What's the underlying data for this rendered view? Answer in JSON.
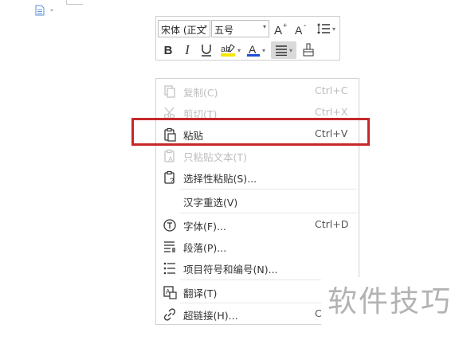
{
  "toolbar": {
    "font_name": "宋体 (正文",
    "font_size": "五号"
  },
  "menu": {
    "items": [
      {
        "label": "复制(C)",
        "shortcut": "Ctrl+C",
        "icon": "copy-icon",
        "disabled": true
      },
      {
        "label": "剪切(T)",
        "shortcut": "Ctrl+X",
        "icon": "scissors-icon",
        "disabled": true
      },
      {
        "label": "粘贴",
        "shortcut": "Ctrl+V",
        "icon": "paste-icon",
        "disabled": false
      },
      {
        "label": "只粘贴文本(T)",
        "shortcut": "",
        "icon": "paste-text-icon",
        "disabled": true
      },
      {
        "label": "选择性粘贴(S)...",
        "shortcut": "",
        "icon": "paste-special-icon",
        "disabled": false
      },
      {
        "label": "汉字重选(V)",
        "shortcut": "",
        "icon": "",
        "disabled": false
      },
      {
        "label": "字体(F)...",
        "shortcut": "Ctrl+D",
        "icon": "font-icon",
        "disabled": false
      },
      {
        "label": "段落(P)...",
        "shortcut": "",
        "icon": "paragraph-icon",
        "disabled": false
      },
      {
        "label": "项目符号和编号(N)...",
        "shortcut": "",
        "icon": "bullet-list-icon",
        "disabled": false
      },
      {
        "label": "翻译(T)",
        "shortcut": "",
        "icon": "translate-icon",
        "disabled": false
      },
      {
        "label": "超链接(H)...",
        "shortcut": "C",
        "icon": "link-icon",
        "disabled": false
      }
    ]
  },
  "watermark": "软件技巧",
  "colors": {
    "highlight": "#c62828",
    "font_color": "#1e4fd8",
    "highlight_color": "#f5e600"
  }
}
